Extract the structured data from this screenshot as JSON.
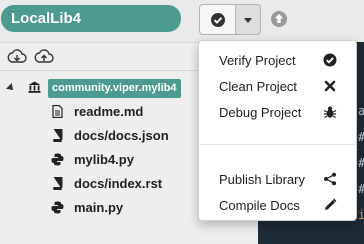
{
  "header": {
    "library_name": "LocalLib4"
  },
  "toolbar": {
    "verify_icon": "check-circle-icon",
    "dropdown_icon": "caret-down-icon",
    "upload_icon": "upload-icon"
  },
  "file_panel": {
    "toolbar_icons": [
      "cloud-download-icon",
      "cloud-upload-icon"
    ],
    "root": {
      "label": "community.viper.mylib4",
      "icon": "library-icon"
    },
    "files": [
      {
        "label": "readme.md",
        "icon": "file-icon"
      },
      {
        "label": "docs/docs.json",
        "icon": "book-icon"
      },
      {
        "label": "mylib4.py",
        "icon": "python-icon"
      },
      {
        "label": "docs/index.rst",
        "icon": "book-icon"
      },
      {
        "label": "main.py",
        "icon": "python-icon"
      }
    ]
  },
  "menu": {
    "items": [
      {
        "label": "Verify Project",
        "icon": "check-circle-icon"
      },
      {
        "label": "Clean Project",
        "icon": "close-icon"
      },
      {
        "label": "Debug Project",
        "icon": "bug-icon"
      },
      {
        "label": "Publish Library",
        "icon": "share-icon"
      },
      {
        "label": "Compile Docs",
        "icon": "pencil-icon"
      }
    ]
  },
  "colors": {
    "accent": "#4d9a90",
    "editor_bg": "#1d2b36",
    "panel_bg": "#eeeeee"
  }
}
